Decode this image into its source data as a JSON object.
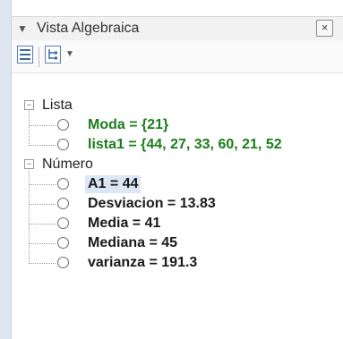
{
  "window": {
    "title": "Vista Algebraica",
    "close_glyph": "×"
  },
  "toolbar": {
    "icons": [
      "algebra-view-icon",
      "tree-structure-icon",
      "dropdown-caret-icon"
    ]
  },
  "tree": {
    "groups": [
      {
        "label": "Lista",
        "items": [
          {
            "text": "Moda = {21}",
            "color": "#1b7d1b"
          },
          {
            "text": "lista1 = {44, 27, 33, 60, 21, 52",
            "color": "#1b7d1b"
          }
        ]
      },
      {
        "label": "Número",
        "items": [
          {
            "text": "A1 = 44",
            "color": "#1a1a1a",
            "selected": true
          },
          {
            "text": "Desviacion = 13.83",
            "color": "#1a1a1a"
          },
          {
            "text": "Media = 41",
            "color": "#1a1a1a"
          },
          {
            "text": "Mediana = 45",
            "color": "#1a1a1a"
          },
          {
            "text": "varianza = 191.3",
            "color": "#1a1a1a"
          }
        ]
      }
    ],
    "collapse_glyph": "−"
  }
}
